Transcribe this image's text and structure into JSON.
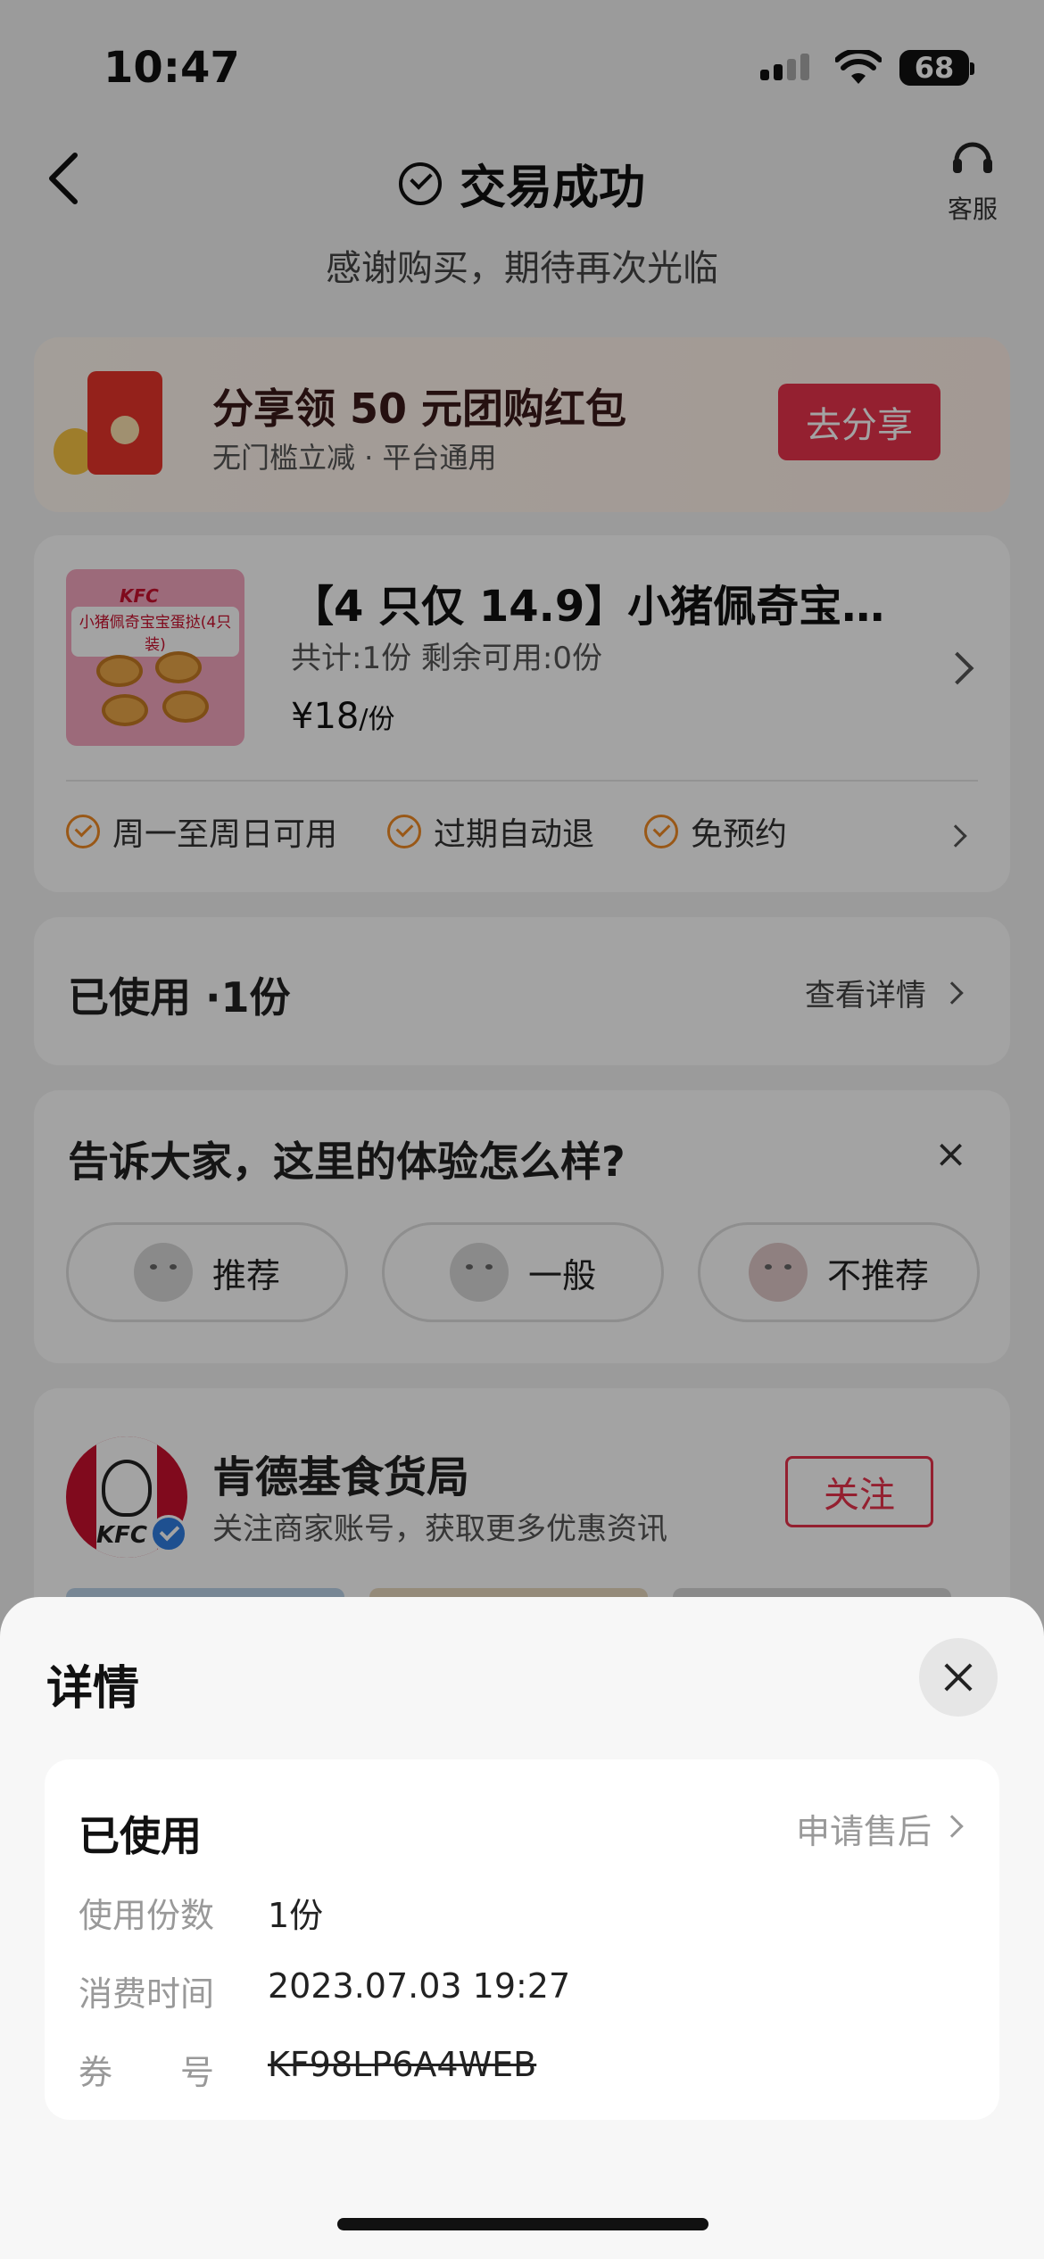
{
  "status_bar": {
    "time": "10:47",
    "battery": "68"
  },
  "header": {
    "title": "交易成功",
    "service_label": "客服",
    "subtitle": "感谢购买，期待再次光临"
  },
  "share_banner": {
    "title": "分享领 50 元团购红包",
    "subtitle": "无门槛立减 · 平台通用",
    "button": "去分享"
  },
  "product": {
    "image_brand": "KFC",
    "image_text": "小猪佩奇宝宝蛋挞(4只装)",
    "title": "【4 只仅 14.9】小猪佩奇宝…",
    "count": "共计:1份  剩余可用:0份",
    "price": "¥18",
    "unit": "/份",
    "tags": [
      "周一至周日可用",
      "过期自动退",
      "免预约"
    ]
  },
  "used_card": {
    "label": "已使用 ·1份",
    "link": "查看详情"
  },
  "experience": {
    "question": "告诉大家，这里的体验怎么样?",
    "close_icon": "×",
    "options": [
      "推荐",
      "一般",
      "不推荐"
    ]
  },
  "store": {
    "logo_text": "KFC",
    "name": "肯德基食货局",
    "desc": "关注商家账号，获取更多优惠资讯",
    "follow": "关注"
  },
  "detail_sheet": {
    "title": "详情",
    "status": "已使用",
    "after_sale": "申请售后",
    "rows": [
      {
        "label": "使用份数",
        "value": "1份"
      },
      {
        "label": "消费时间",
        "value": "2023.07.03 19:27"
      },
      {
        "label": "券　　号",
        "value": "KF98LP6A4WEB"
      }
    ]
  },
  "colors": {
    "accent": "#e8324c",
    "tag_check": "#f08a24",
    "verify": "#2f7de1"
  }
}
